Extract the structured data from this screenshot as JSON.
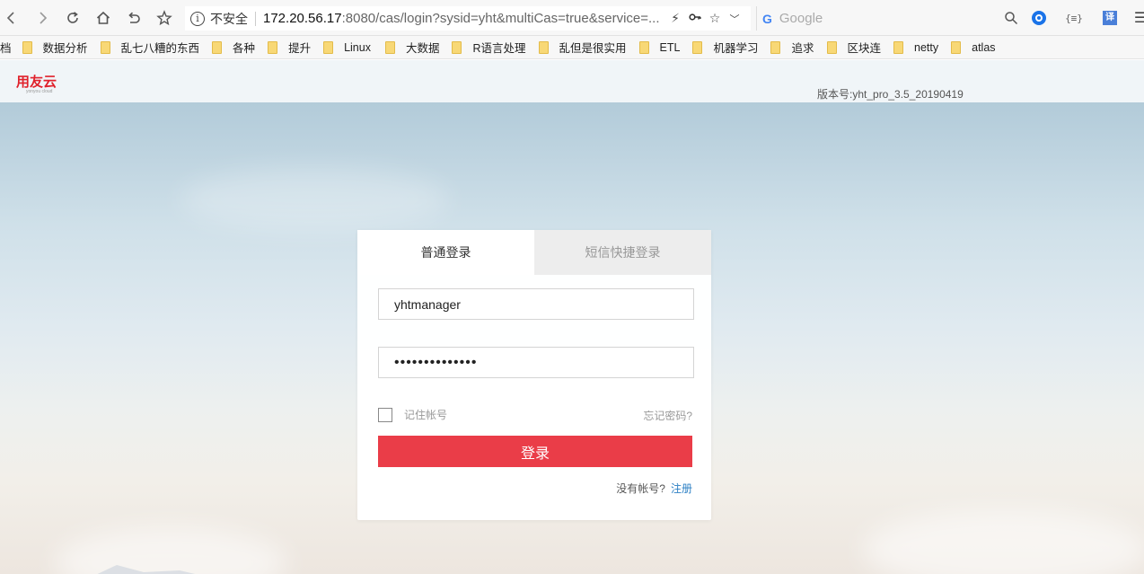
{
  "browser": {
    "address": {
      "security_text": "不安全",
      "url_host": "172.20.56.17",
      "url_rest": ":8080/cas/login?sysid=yht&multiCas=true&service=..."
    },
    "search": {
      "placeholder": "Google",
      "engine_glyph": "G"
    },
    "extensions": {
      "braces": "{≡}",
      "translate": "译"
    },
    "bookmarks": [
      "档",
      "数据分析",
      "乱七八糟的东西",
      "各种",
      "提升",
      "Linux",
      "大数据",
      "R语言处理",
      "乱但是很实用",
      "ETL",
      "机器学习",
      "追求",
      "区块连",
      "netty",
      "atlas"
    ]
  },
  "page": {
    "logo_cn": "用友云",
    "logo_en": "yonyou cloud",
    "version": "版本号:yht_pro_3.5_20190419"
  },
  "login": {
    "tab_normal": "普通登录",
    "tab_sms": "短信快捷登录",
    "username_value": "yhtmanager",
    "password_value": "••••••••••••••",
    "remember_label": "记住帐号",
    "forgot_label": "忘记密码?",
    "submit_label": "登录",
    "no_account_text": "没有帐号?",
    "register_label": "注册"
  },
  "colors": {
    "accent_red": "#ea3d48",
    "link_blue": "#2b7fc4",
    "logo_red": "#e0212b"
  }
}
